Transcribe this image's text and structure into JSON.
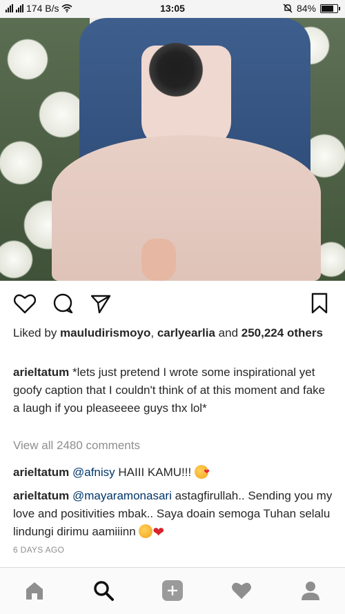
{
  "status_bar": {
    "network_speed": "174 B/s",
    "time": "13:05",
    "battery": "84%",
    "battery_level": 0.84
  },
  "photo": {
    "icon": "photo-post"
  },
  "actions": {
    "like_icon": "heart-icon",
    "comment_icon": "comment-icon",
    "share_icon": "send-icon",
    "save_icon": "bookmark-icon"
  },
  "likes": {
    "prefix": "Liked by ",
    "user1": "mauludirismoyo",
    "sep": ", ",
    "user2": "carlyearlia",
    "and": " and ",
    "count": "250,224 others"
  },
  "caption": {
    "username": "arieltatum",
    "text": " *lets just pretend I wrote some inspirational yet goofy caption that I couldn't think of at this moment and fake a laugh if you pleaseeee guys thx lol*"
  },
  "view_all": "View all 2480 comments",
  "comments": [
    {
      "username": "arieltatum",
      "mention": "@afnisy",
      "text": " HAIII KAMU!!! ",
      "emoji": "kiss-face-emoji"
    },
    {
      "username": "arieltatum",
      "mention": "@mayaramonasari",
      "text": " astagfirullah.. Sending you my love and positivities mbak.. Saya doain semoga Tuhan selalu lindungi dirimu aamiiinn ",
      "emoji": "hug-face-emoji, heart-emoji"
    }
  ],
  "timestamp": "6 DAYS AGO",
  "nav": {
    "home": "home-icon",
    "search": "search-icon",
    "add": "add-icon",
    "activity": "heart-icon",
    "profile": "profile-icon"
  }
}
